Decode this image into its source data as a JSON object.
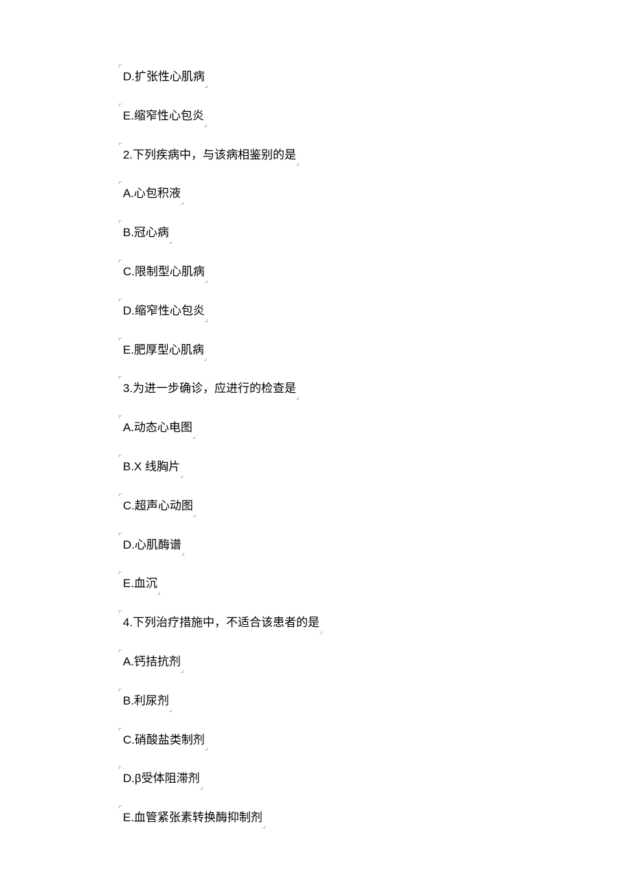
{
  "lines": [
    "D.扩张性心肌病",
    "E.缩窄性心包炎",
    "2.下列疾病中，与该病相鉴别的是",
    "A.心包积液",
    "B.冠心病",
    "C.限制型心肌病",
    "D.缩窄性心包炎",
    "E.肥厚型心肌病",
    "3.为进一步确诊，应进行的检查是",
    "A.动态心电图",
    "B.X 线胸片",
    "C.超声心动图",
    "D.心肌酶谱",
    "E.血沉",
    "4.下列治疗措施中，不适合该患者的是",
    "A.钙拮抗剂",
    "B.利尿剂",
    "C.硝酸盐类制剂",
    "D.β受体阻滞剂",
    "E.血管紧张素转换酶抑制剂"
  ]
}
